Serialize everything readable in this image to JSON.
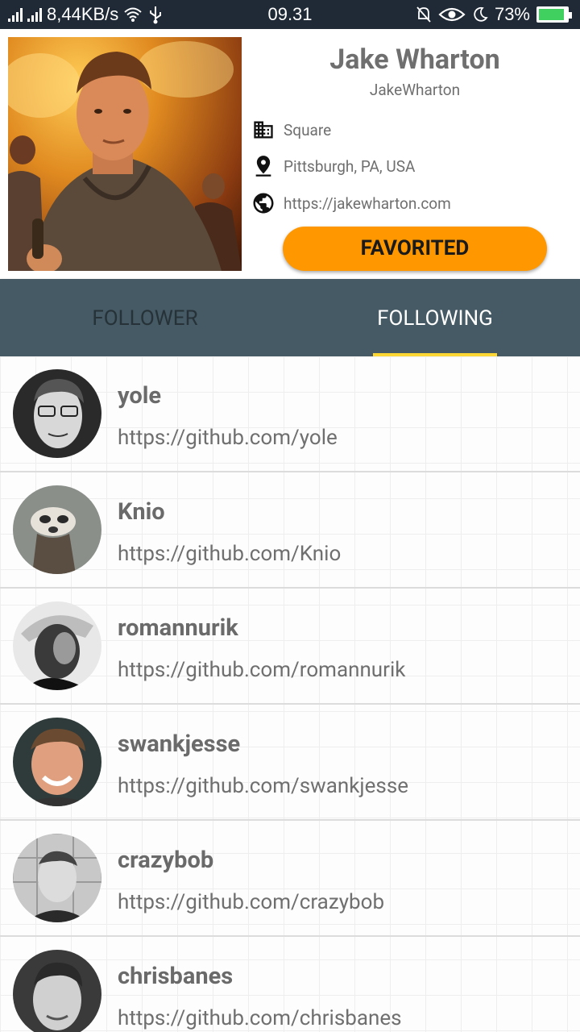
{
  "status_bar": {
    "speed": "8,44KB/s",
    "time": "09.31",
    "battery": "73%"
  },
  "profile": {
    "name": "Jake Wharton",
    "login": "JakeWharton",
    "company": "Square",
    "location": "Pittsburgh, PA, USA",
    "blog": "https://jakewharton.com",
    "favorite_label": "FAVORITED",
    "colors": {
      "accent": "#ff9800"
    }
  },
  "tabs": {
    "follower_label": "FOLLOWER",
    "following_label": "FOLLOWING",
    "selected": "FOLLOWING",
    "colors": {
      "bar": "#455a64",
      "indicator": "#fdd835"
    }
  },
  "list": {
    "items": [
      {
        "name": "yole",
        "url": "https://github.com/yole"
      },
      {
        "name": "Knio",
        "url": "https://github.com/Knio"
      },
      {
        "name": "romannurik",
        "url": "https://github.com/romannurik"
      },
      {
        "name": "swankjesse",
        "url": "https://github.com/swankjesse"
      },
      {
        "name": "crazybob",
        "url": "https://github.com/crazybob"
      },
      {
        "name": "chrisbanes",
        "url": "https://github.com/chrisbanes"
      }
    ]
  }
}
